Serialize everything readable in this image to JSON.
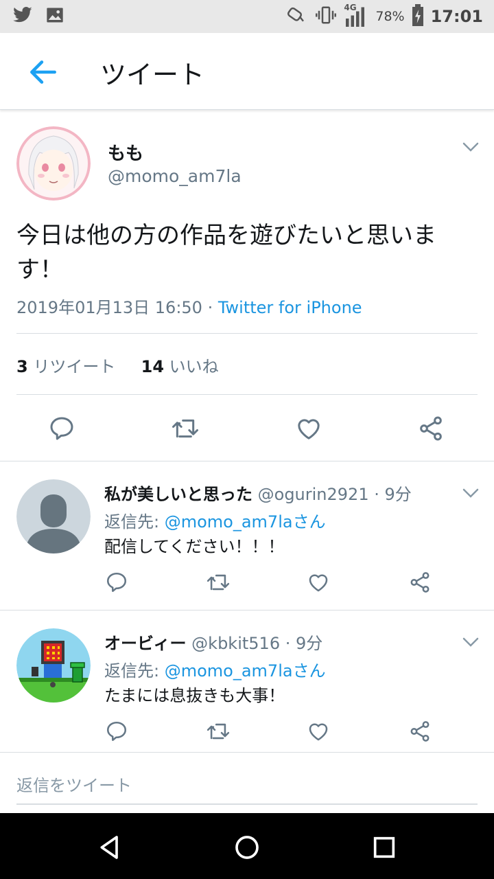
{
  "status_bar": {
    "battery": "78%",
    "time": "17:01",
    "network": "4G"
  },
  "app_bar": {
    "title": "ツイート"
  },
  "main_tweet": {
    "display_name": "もも",
    "handle": "@momo_am7la",
    "text": "今日は他の方の作品を遊びたいと思います！",
    "datetime": "2019年01月13日 16:50",
    "separator": " · ",
    "source": "Twitter for iPhone",
    "retweet_count": "3",
    "retweet_label": "リツイート",
    "like_count": "14",
    "like_label": "いいね"
  },
  "replies": [
    {
      "display_name": "私が美しいと思った",
      "handle": "@ogurin2921",
      "time": "· 9分",
      "reply_to_label": "返信先: ",
      "reply_to_handle": "@momo_am7laさん",
      "text": "配信してください！！！"
    },
    {
      "display_name": "オービィー",
      "handle": "@kbkit516",
      "time": "· 9分",
      "reply_to_label": "返信先: ",
      "reply_to_handle": "@momo_am7laさん",
      "text": "たまには息抜きも大事！"
    }
  ],
  "compose": {
    "placeholder": "返信をツイート"
  },
  "colors": {
    "accent": "#1da1f2",
    "link": "#1b95e0",
    "muted": "#657786",
    "icon": "#657786"
  }
}
